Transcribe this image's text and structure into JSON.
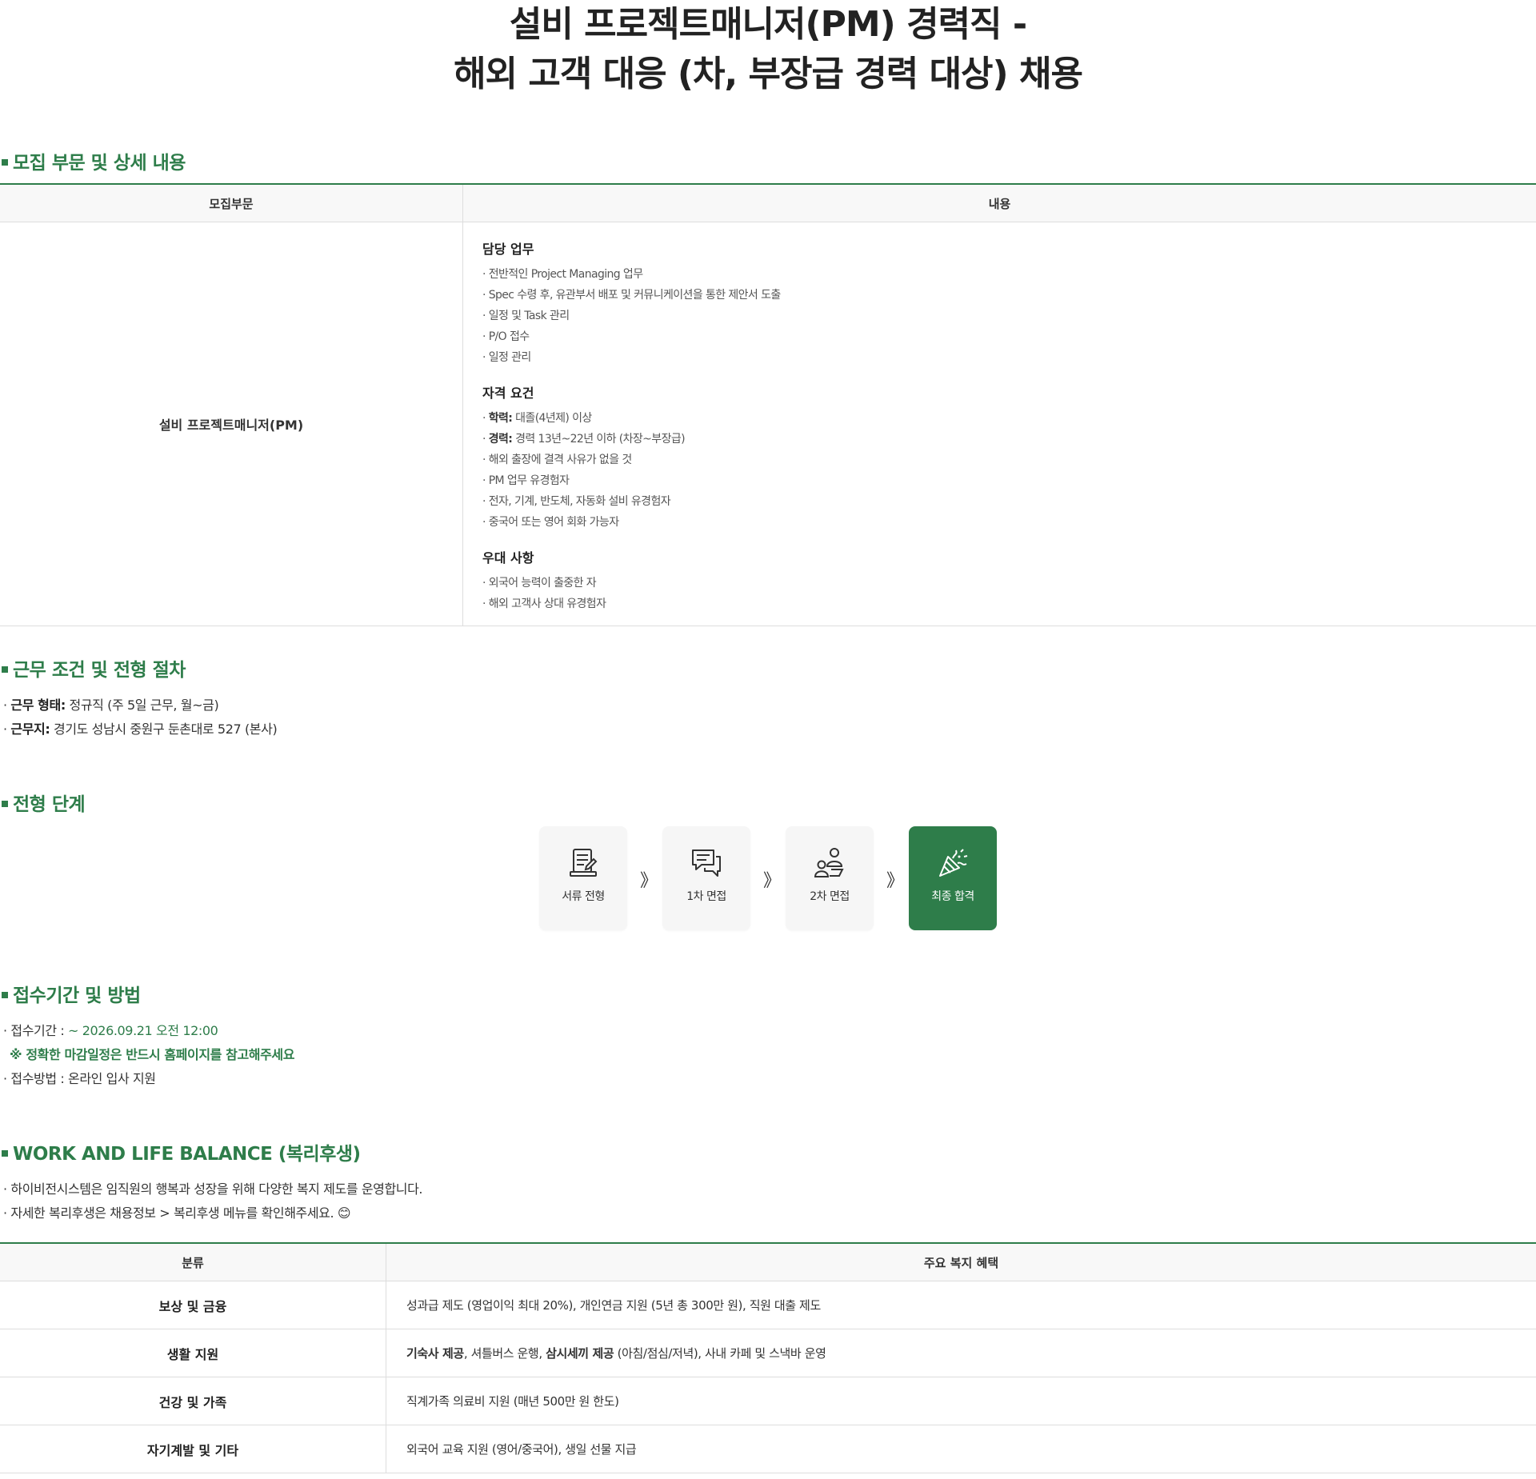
{
  "title": {
    "line1": "설비 프로젝트매니저(PM) 경력직 -",
    "line2": "해외 고객 대응 (차, 부장급 경력 대상) 채용"
  },
  "recruit": {
    "heading": "모집 부문 및 상세 내용",
    "col_headers": [
      "모집부문",
      "내용"
    ],
    "role": "설비 프로젝트매니저(PM)",
    "duties_title": "담당 업무",
    "duties": [
      "전반적인 Project Managing 업무",
      "Spec 수령 후, 유관부서 배포 및 커뮤니케이션을 통한 제안서 도출",
      "일정 및 Task 관리",
      "P/O 접수",
      "일정 관리"
    ],
    "qual_title": "자격 요건",
    "qual_items": [
      {
        "label": "학력:",
        "text": "대졸(4년제) 이상"
      },
      {
        "label": "경력:",
        "text": "경력 13년~22년 이하 (차장~부장급)"
      },
      {
        "label": "",
        "text": "해외 출장에 결격 사유가 없을 것"
      },
      {
        "label": "",
        "text": "PM 업무 유경험자"
      },
      {
        "label": "",
        "text": "전자, 기계, 반도체, 자동화 설비 유경험자"
      },
      {
        "label": "",
        "text": "중국어 또는 영어 회화 가능자"
      }
    ],
    "pref_title": "우대 사항",
    "pref_items": [
      "외국어 능력이 출중한 자",
      "해외 고객사 상대 유경험자"
    ]
  },
  "conditions": {
    "heading": "근무 조건 및 전형 절차",
    "type_label": "근무 형태:",
    "type_value": "정규직 (주 5일 근무, 월~금)",
    "loc_label": "근무지:",
    "loc_value": "경기도 성남시 중원구 둔촌대로 527 (본사)"
  },
  "process": {
    "heading": "전형 단계",
    "steps": [
      {
        "label": "서류 전형",
        "icon": "document-icon"
      },
      {
        "label": "1차 면접",
        "icon": "chat-icon"
      },
      {
        "label": "2차 면접",
        "icon": "people-icon"
      },
      {
        "label": "최종 합격",
        "icon": "party-popper-icon"
      }
    ],
    "arrow": "》",
    "accent": "#2e7d4a"
  },
  "apply": {
    "heading": "접수기간 및 방법",
    "period_label": "접수기간 :",
    "period_value": "~ 2026.09.21 오전 12:00",
    "notice": "※ 정확한 마감일정은 반드시 홈페이지를 참고해주세요",
    "method": "접수방법 : 온라인 입사 지원"
  },
  "welfare": {
    "heading": "WORK AND LIFE BALANCE (복리후생)",
    "intro1": "하이비전시스템은 임직원의 행복과 성장을 위해 다양한 복지 제도를 운영합니다.",
    "intro2": "자세한 복리후생은 채용정보 > 복리후생 메뉴를 확인해주세요. 😊",
    "col_headers": [
      "분류",
      "주요 복지 혜택"
    ],
    "rows": [
      {
        "category": "보상 및 금융",
        "b1": "",
        "t1": "성과급 제도 (영업이익 최대 20%), 개인연금 지원 (5년 총 300만 원), 직원 대출 제도",
        "b2": "",
        "t2": ""
      },
      {
        "category": "생활 지원",
        "b1": "기숙사 제공",
        "t1": ", 셔틀버스 운행, ",
        "b2": "삼시세끼 제공",
        "t2": " (아침/점심/저녁), 사내 카페 및 스낵바 운영"
      },
      {
        "category": "건강 및 가족",
        "b1": "",
        "t1": "직계가족 의료비 지원 (매년 500만 원 한도)",
        "b2": "",
        "t2": ""
      },
      {
        "category": "자기계발 및 기타",
        "b1": "",
        "t1": "외국어 교육 지원 (영어/중국어), 생일 선물 지급",
        "b2": "",
        "t2": ""
      }
    ]
  },
  "bullet": "·"
}
